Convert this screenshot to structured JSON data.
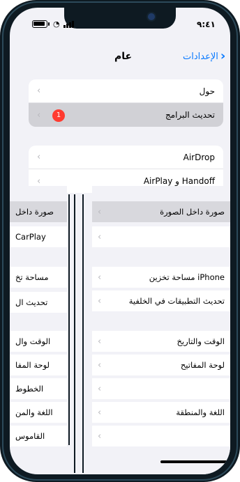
{
  "status": {
    "time": "٩:٤١"
  },
  "nav": {
    "title": "عام",
    "back_label": "الإعدادات"
  },
  "group1": [
    {
      "label": "حول"
    },
    {
      "label": "تحديث البرامج",
      "badge": "1"
    }
  ],
  "group2": [
    {
      "label": "AirDrop"
    },
    {
      "label": "AirPlay و Handoff"
    }
  ],
  "left_fragments": {
    "row_a": "صورة داخل",
    "row_b": "CarPlay",
    "row_c": "مساحة تخ",
    "row_d": "تحديث ال",
    "row_e": "الوقت وال",
    "row_f": "لوحة المفا",
    "row_g": "الخطوط",
    "row_h": "اللغة والمن",
    "row_i": "القاموس"
  },
  "right_fragments": {
    "row_a": "صورة داخل الصورة",
    "row_c": "مساحة تخزين iPhone",
    "row_d": "تحديث التطبيقات في الخلفية",
    "row_e": "الوقت والتاريخ",
    "row_f": "لوحة المفاتيح",
    "row_h": "اللغة والمنطقة"
  }
}
